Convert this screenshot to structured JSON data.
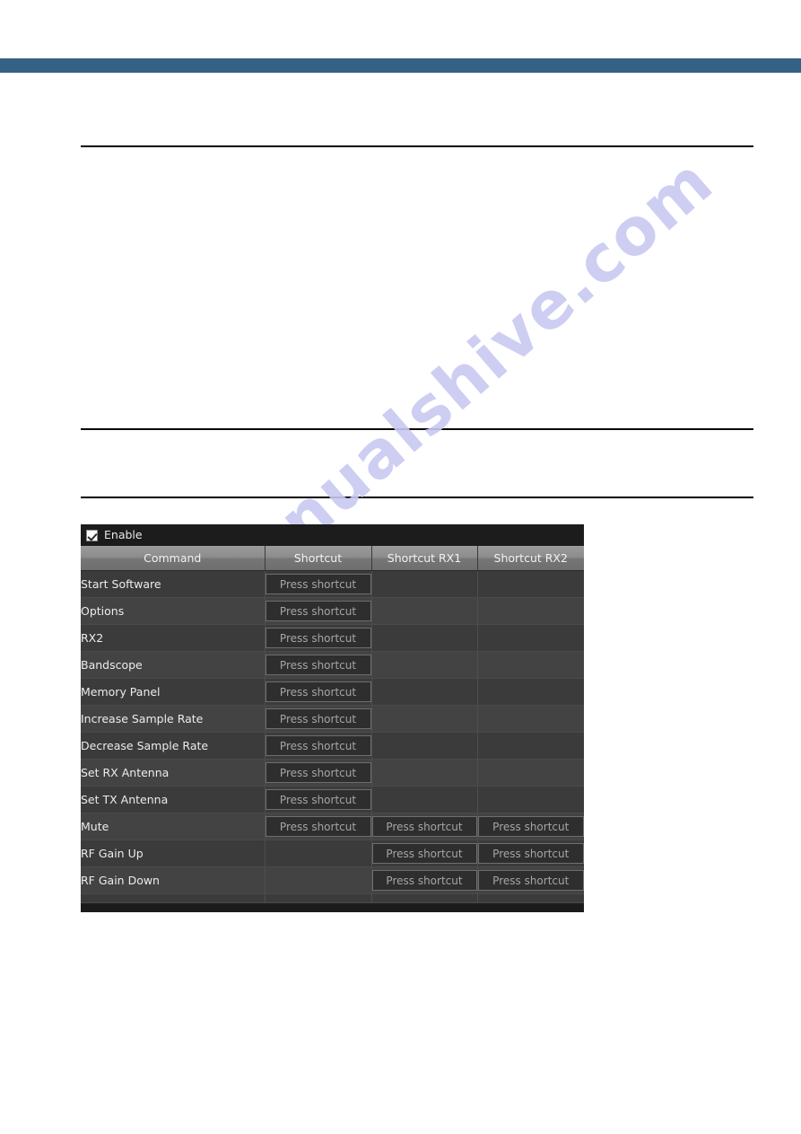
{
  "page": {
    "background_color": "#ffffff",
    "banner_color": "#336285"
  },
  "watermark": {
    "text": "manualshive.com",
    "color": "#c9c9f2"
  },
  "app_panel": {
    "enable_checkbox": {
      "label": "Enable",
      "checked": true
    },
    "table": {
      "columns": [
        "Command",
        "Shortcut",
        "Shortcut RX1",
        "Shortcut RX2"
      ],
      "button_label": "Press shortcut",
      "rows": [
        {
          "command": "Start Software",
          "shortcut": "Press shortcut",
          "rx1": "",
          "rx2": ""
        },
        {
          "command": "Options",
          "shortcut": "Press shortcut",
          "rx1": "",
          "rx2": ""
        },
        {
          "command": "RX2",
          "shortcut": "Press shortcut",
          "rx1": "",
          "rx2": ""
        },
        {
          "command": "Bandscope",
          "shortcut": "Press shortcut",
          "rx1": "",
          "rx2": ""
        },
        {
          "command": "Memory Panel",
          "shortcut": "Press shortcut",
          "rx1": "",
          "rx2": ""
        },
        {
          "command": "Increase Sample Rate",
          "shortcut": "Press shortcut",
          "rx1": "",
          "rx2": ""
        },
        {
          "command": "Decrease Sample Rate",
          "shortcut": "Press shortcut",
          "rx1": "",
          "rx2": ""
        },
        {
          "command": "Set RX Antenna",
          "shortcut": "Press shortcut",
          "rx1": "",
          "rx2": ""
        },
        {
          "command": "Set TX Antenna",
          "shortcut": "Press shortcut",
          "rx1": "",
          "rx2": ""
        },
        {
          "command": "Mute",
          "shortcut": "Press shortcut",
          "rx1": "Press shortcut",
          "rx2": "Press shortcut"
        },
        {
          "command": "RF Gain Up",
          "shortcut": "",
          "rx1": "Press shortcut",
          "rx2": "Press shortcut"
        },
        {
          "command": "RF Gain Down",
          "shortcut": "",
          "rx1": "Press shortcut",
          "rx2": "Press shortcut"
        }
      ]
    }
  }
}
